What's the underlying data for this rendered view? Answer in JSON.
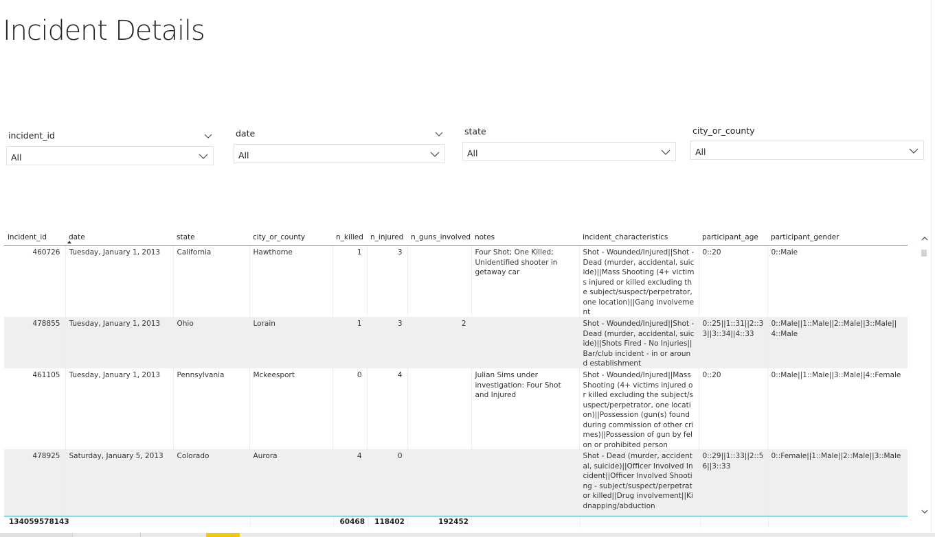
{
  "page": {
    "title": "Incident Details"
  },
  "slicers": [
    {
      "label": "incident_id",
      "value": "All"
    },
    {
      "label": "date",
      "value": "All"
    },
    {
      "label": "state",
      "value": "All"
    },
    {
      "label": "city_or_county",
      "value": "All"
    }
  ],
  "table": {
    "columns": [
      "incident_id",
      "date",
      "state",
      "city_or_county",
      "n_killed",
      "n_injured",
      "n_guns_involved",
      "notes",
      "incident_characteristics",
      "participant_age",
      "participant_gender"
    ],
    "rows": [
      [
        "460726",
        "Tuesday, January 1, 2013",
        "California",
        "Hawthorne",
        "1",
        "3",
        "",
        "Four Shot; One Killed; Unidentified shooter in getaway car",
        "Shot - Wounded/Injured||Shot - Dead (murder, accidental, suicide)||Mass Shooting (4+ victims injured or killed excluding the subject/suspect/perpetrator, one location)||Gang involvement",
        "0::20",
        "0::Male"
      ],
      [
        "478855",
        "Tuesday, January 1, 2013",
        "Ohio",
        "Lorain",
        "1",
        "3",
        "2",
        "",
        "Shot - Wounded/Injured||Shot - Dead (murder, accidental, suicide)||Shots Fired - No Injuries||Bar/club incident - in or around establishment",
        "0::25||1::31||2::33||3::34||4::33",
        "0::Male||1::Male||2::Male||3::Male||4::Male"
      ],
      [
        "461105",
        "Tuesday, January 1, 2013",
        "Pennsylvania",
        "Mckeesport",
        "0",
        "4",
        "",
        "Julian Sims under investigation: Four Shot and Injured",
        "Shot - Wounded/Injured||Mass Shooting (4+ victims injured or killed excluding the subject/suspect/perpetrator, one location)||Possession (gun(s) found during commission of other crimes)||Possession of gun by felon or prohibited person",
        "0::20",
        "0::Male||1::Male||3::Male||4::Female"
      ],
      [
        "478925",
        "Saturday, January 5, 2013",
        "Colorado",
        "Aurora",
        "4",
        "0",
        "",
        "",
        "Shot - Dead (murder, accidental, suicide)||Officer Involved Incident||Officer Involved Shooting - subject/suspect/perpetrator killed||Drug involvement||Kidnapping/abduction",
        "0::29||1::33||2::56||3::33",
        "0::Female||1::Male||2::Male||3::Male"
      ]
    ],
    "totals": {
      "incident_id": "134059578143",
      "n_killed": "60468",
      "n_injured": "118402",
      "n_guns_involved": "192452"
    }
  }
}
